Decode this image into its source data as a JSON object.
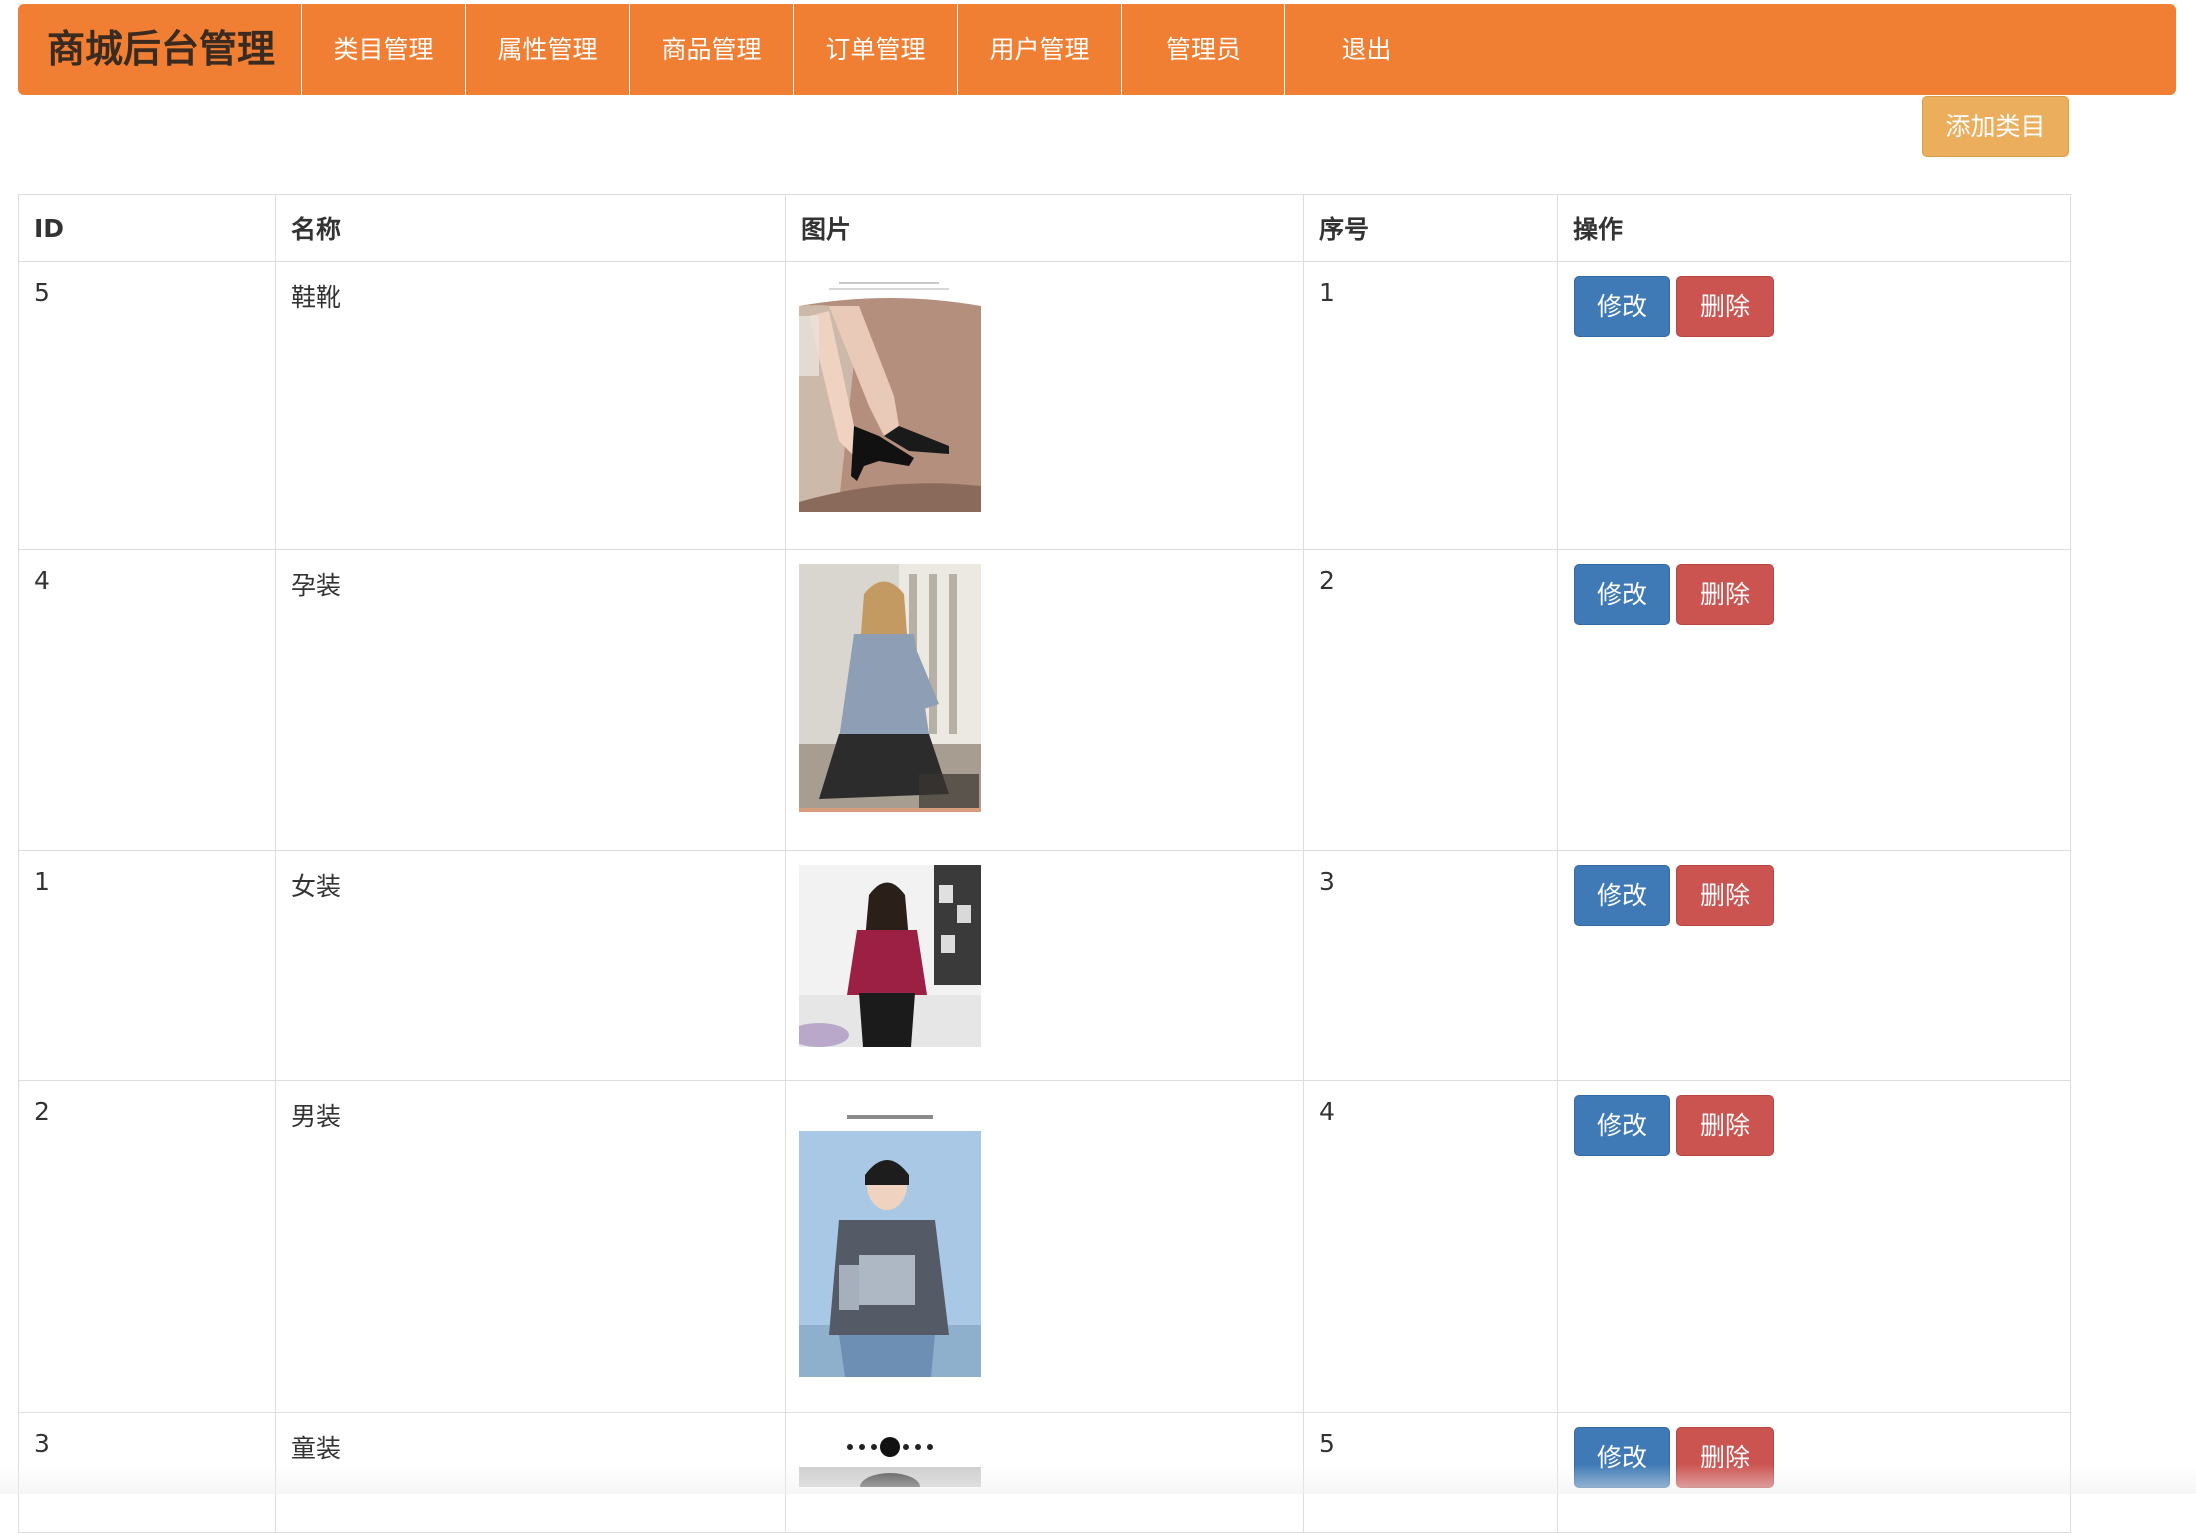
{
  "navbar": {
    "brand": "商城后台管理",
    "items": [
      {
        "label": "类目管理"
      },
      {
        "label": "属性管理"
      },
      {
        "label": "商品管理"
      },
      {
        "label": "订单管理"
      },
      {
        "label": "用户管理"
      },
      {
        "label": "管理员"
      },
      {
        "label": "退出"
      }
    ]
  },
  "toolbar": {
    "add_label": "添加类目"
  },
  "table": {
    "headers": {
      "id": "ID",
      "name": "名称",
      "image": "图片",
      "order": "序号",
      "actions": "操作"
    },
    "rows": [
      {
        "id": "5",
        "name": "鞋靴",
        "order": "1",
        "image_icon": "shoes-photo",
        "edit_label": "修改",
        "delete_label": "删除"
      },
      {
        "id": "4",
        "name": "孕装",
        "order": "2",
        "image_icon": "maternity-photo",
        "edit_label": "修改",
        "delete_label": "删除"
      },
      {
        "id": "1",
        "name": "女装",
        "order": "3",
        "image_icon": "womens-photo",
        "edit_label": "修改",
        "delete_label": "删除"
      },
      {
        "id": "2",
        "name": "男装",
        "order": "4",
        "image_icon": "mens-photo",
        "edit_label": "修改",
        "delete_label": "删除"
      },
      {
        "id": "3",
        "name": "童装",
        "order": "5",
        "image_icon": "kids-photo",
        "edit_label": "修改",
        "delete_label": "删除"
      }
    ]
  },
  "colors": {
    "navbar": "#F07F33",
    "add_button": "#EBAE5C",
    "edit_button": "#3F7AB6",
    "delete_button": "#CC5450"
  }
}
